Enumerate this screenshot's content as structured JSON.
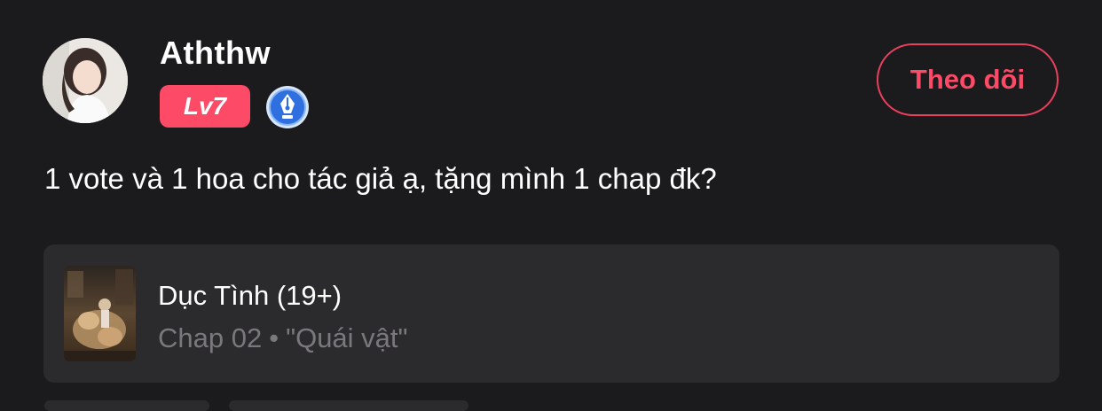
{
  "user": {
    "name": "Aththw",
    "level": "Lv7",
    "badge_icon": "pen-nib-icon"
  },
  "follow_button": {
    "label": "Theo dõi"
  },
  "comment": {
    "text": "1 vote và 1 hoa cho tác giả ạ, tặng mình 1 chap đk?"
  },
  "chapter_card": {
    "title": "Dục Tình (19+)",
    "chapter": "Chap 02",
    "separator": "•",
    "chapter_name": "\"Quái vật\""
  },
  "colors": {
    "background": "#1b1a1c",
    "accent": "#fc4a67",
    "card": "#2b2a2d",
    "muted_text": "#7a787d"
  }
}
